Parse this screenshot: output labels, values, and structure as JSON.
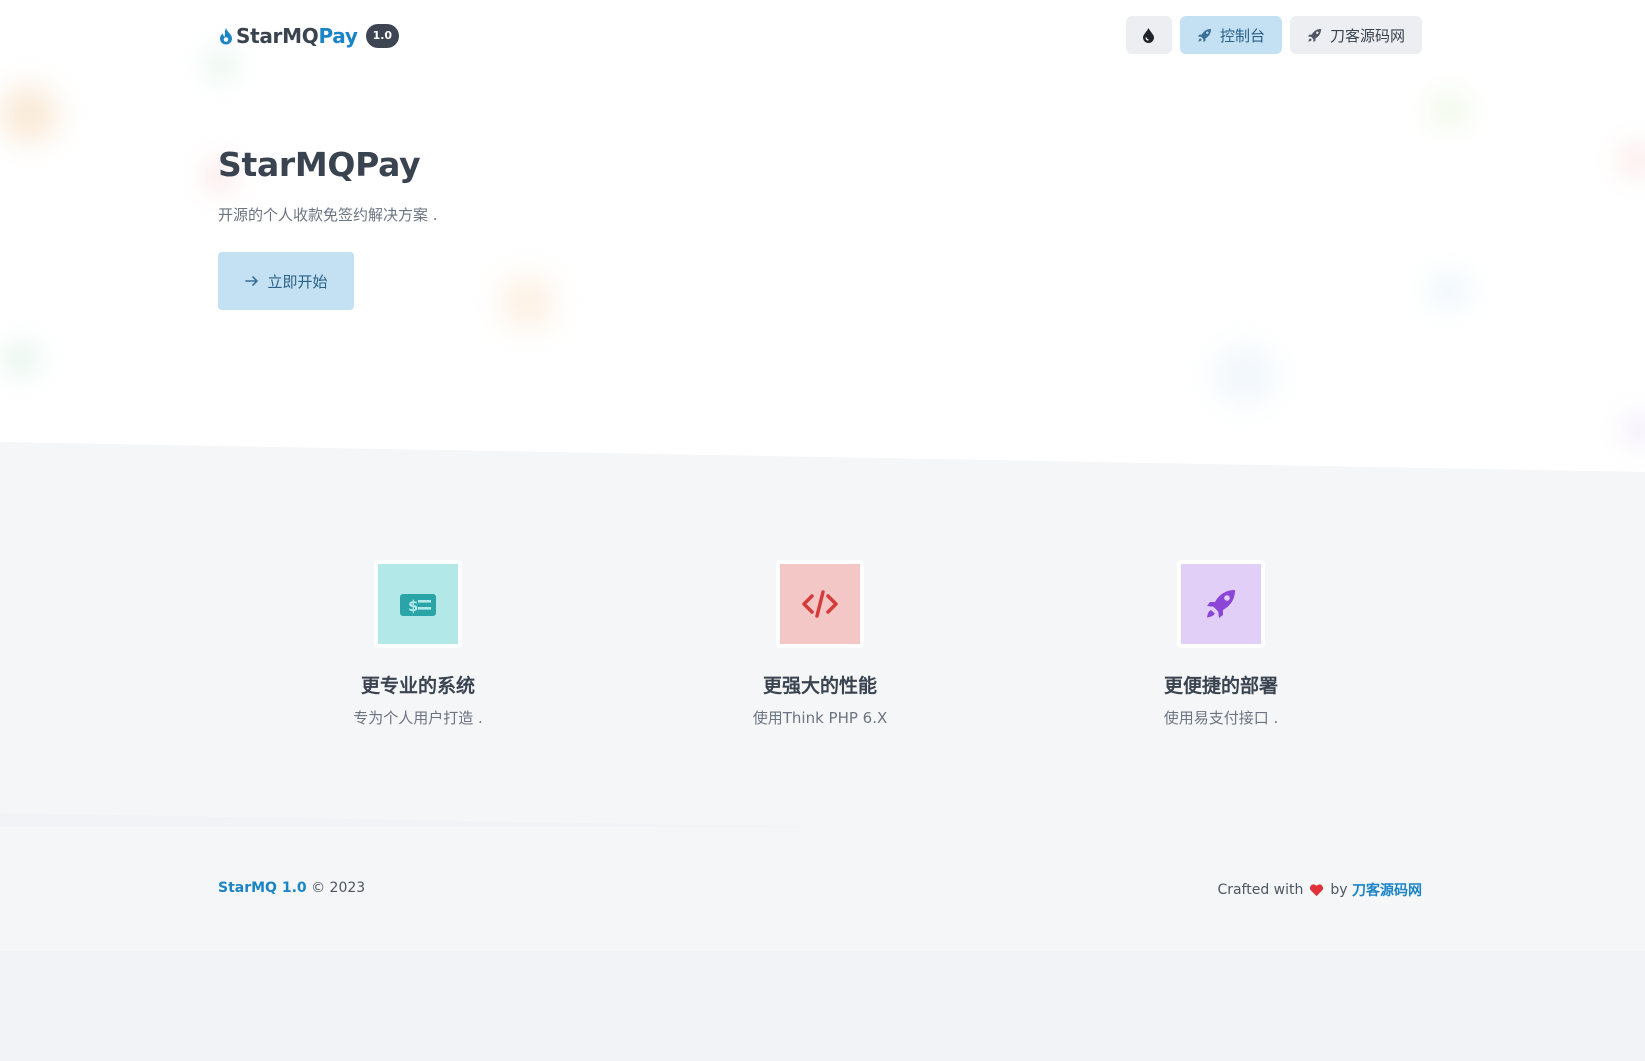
{
  "colors": {
    "brand": "#1b84c6",
    "dark": "#3a4350",
    "muted": "#6b7480",
    "console_btn_bg": "#c3e1f2",
    "feature1_bg": "#b2e9e8",
    "feature1_fg": "#2aa4a6",
    "feature2_bg": "#f4c7c7",
    "feature2_fg": "#d63b3b",
    "feature3_bg": "#e2cff7",
    "feature3_fg": "#8b46d8",
    "heart": "#e0323a"
  },
  "header": {
    "logo_icon": "fire-drop-icon",
    "logo_part1": "StarMQ",
    "logo_part2": "Pay",
    "version": "1.0",
    "theme_button_icon": "drop-icon",
    "console_label": "控制台",
    "console_icon": "rocket-icon",
    "site_label": "刀客源码网",
    "site_icon": "rocket-icon"
  },
  "hero": {
    "title": "StarMQPay",
    "subtitle": "开源的个人收款免签约解决方案 .",
    "start_label": "立即开始",
    "start_icon": "arrow-right-icon"
  },
  "features": [
    {
      "icon": "money-bill-icon",
      "title": "更专业的系统",
      "desc": "专为个人用户打造 ."
    },
    {
      "icon": "code-icon",
      "title": "更强大的性能",
      "desc": "使用Think PHP 6.X"
    },
    {
      "icon": "rocket-icon",
      "title": "更便捷的部署",
      "desc": "使用易支付接口 ."
    }
  ],
  "footer": {
    "brand": "StarMQ 1.0",
    "copyright": " © 2023",
    "crafted": "Crafted with",
    "heart_icon": "heart-icon",
    "by": "by ",
    "author": "刀客源码网"
  }
}
